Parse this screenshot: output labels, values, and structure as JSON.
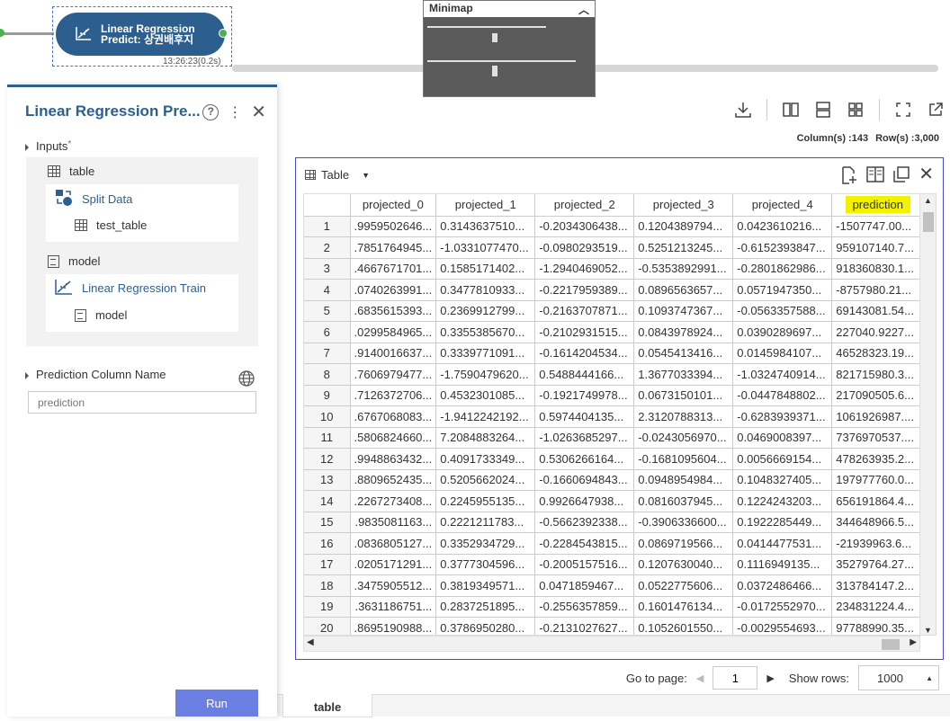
{
  "canvas": {
    "node_title_line1": "Linear Regression",
    "node_title_line2": "Predict: 상권배후지",
    "node_time": "13:26:23(0.2s)",
    "minimap_title": "Minimap"
  },
  "panel": {
    "title": "Linear Regression Pre...",
    "inputs_label": "Inputs",
    "required_mark": "*",
    "input_table_label": "table",
    "split_data_label": "Split Data",
    "test_table_label": "test_table",
    "input_model_label": "model",
    "lr_train_label": "Linear Regression Train",
    "model_label": "model",
    "pred_col_label": "Prediction Column Name",
    "pred_col_placeholder": "prediction",
    "run_label": "Run"
  },
  "info": {
    "columns": "Column(s) :143",
    "rows": "Row(s) :3,000"
  },
  "table_panel": {
    "view_label": "Table",
    "columns": [
      "projected_0",
      "projected_1",
      "projected_2",
      "projected_3",
      "projected_4",
      "prediction"
    ],
    "rows": [
      [
        "1",
        ".9959502646...",
        "0.3143637510...",
        "-0.2034306438...",
        "0.1204389794...",
        "0.0423610216...",
        "-1507747.00..."
      ],
      [
        "2",
        ".7851764945...",
        "-1.0331077470...",
        "-0.0980293519...",
        "0.5251213245...",
        "-0.6152393847...",
        "959107140.7..."
      ],
      [
        "3",
        ".4667671701...",
        "0.1585171402...",
        "-1.2940469052...",
        "-0.5353892991...",
        "-0.2801862986...",
        "918360830.1..."
      ],
      [
        "4",
        ".0740263991...",
        "0.3477810933...",
        "-0.2217959389...",
        "0.0896563657...",
        "0.0571947350...",
        "-8757980.21..."
      ],
      [
        "5",
        ".6835615393...",
        "0.2369912799...",
        "-0.2163707871...",
        "0.1093747367...",
        "-0.0563357588...",
        "69143081.54..."
      ],
      [
        "6",
        ".0299584965...",
        "0.3355385670...",
        "-0.2102931515...",
        "0.0843978924...",
        "0.0390289697...",
        "227040.9227..."
      ],
      [
        "7",
        ".9140016637...",
        "0.3339771091...",
        "-0.1614204534...",
        "0.0545413416...",
        "0.0145984107...",
        "46528323.19..."
      ],
      [
        "8",
        ".7606979477...",
        "-1.7590479620...",
        "0.5488444166...",
        "1.3677033394...",
        "-1.0324740914...",
        "821715980.3..."
      ],
      [
        "9",
        ".7126372706...",
        "0.4532301085...",
        "-0.1921749978...",
        "0.0673150101...",
        "-0.0447848802...",
        "217090505.6..."
      ],
      [
        "10",
        ".6767068083...",
        "-1.9412242192...",
        "0.5974404135...",
        "2.3120788313...",
        "-0.6283939371...",
        "1061926987...."
      ],
      [
        "11",
        ".5806824660...",
        "7.2084883264...",
        "-1.0263685297...",
        "-0.0243056970...",
        "0.0469008397...",
        "7376970537...."
      ],
      [
        "12",
        ".9948863432...",
        "0.4091733349...",
        "0.5306266164...",
        "-0.1681095604...",
        "0.0056669154...",
        "478263935.2..."
      ],
      [
        "13",
        ".8809652435...",
        "0.5205662024...",
        "-0.1660694843...",
        "0.0948954984...",
        "0.1048327405...",
        "197977760.0..."
      ],
      [
        "14",
        ".2267273408...",
        "0.2245955135...",
        "0.9926647938...",
        "0.0816037945...",
        "0.1224243203...",
        "656191864.4..."
      ],
      [
        "15",
        ".9835081163...",
        "0.2221211783...",
        "-0.5662392338...",
        "-0.3906336600...",
        "0.1922285449...",
        "344648966.5..."
      ],
      [
        "16",
        ".0836805127...",
        "0.3352934729...",
        "-0.2284543815...",
        "0.0869719566...",
        "0.0414477531...",
        "-21939963.6..."
      ],
      [
        "17",
        ".0205171291...",
        "0.3777304596...",
        "-0.2005157516...",
        "0.1207630040...",
        "0.1116949135...",
        "35279764.27..."
      ],
      [
        "18",
        ".3475905512...",
        "0.3819349571...",
        "0.0471859467...",
        "0.0522775606...",
        "0.0372486466...",
        "313784147.2..."
      ],
      [
        "19",
        ".3631186751...",
        "0.2837251895...",
        "-0.2556357859...",
        "0.1601476134...",
        "-0.0172552970...",
        "234831224.4..."
      ],
      [
        "20",
        ".8695190988...",
        "0.3786950280...",
        "-0.2131027627...",
        "0.1052601550...",
        "-0.0029554693...",
        "97788990.35..."
      ]
    ]
  },
  "pager": {
    "goto_label": "Go to page:",
    "page_value": "1",
    "show_rows_label": "Show rows:",
    "rows_value": "1000"
  },
  "tabs": {
    "active_tab": "table"
  },
  "colors": {
    "accent": "#2d5f8e",
    "run_button": "#6b7fe3",
    "highlight": "#f2f200",
    "table_border": "#4a4ad0"
  }
}
